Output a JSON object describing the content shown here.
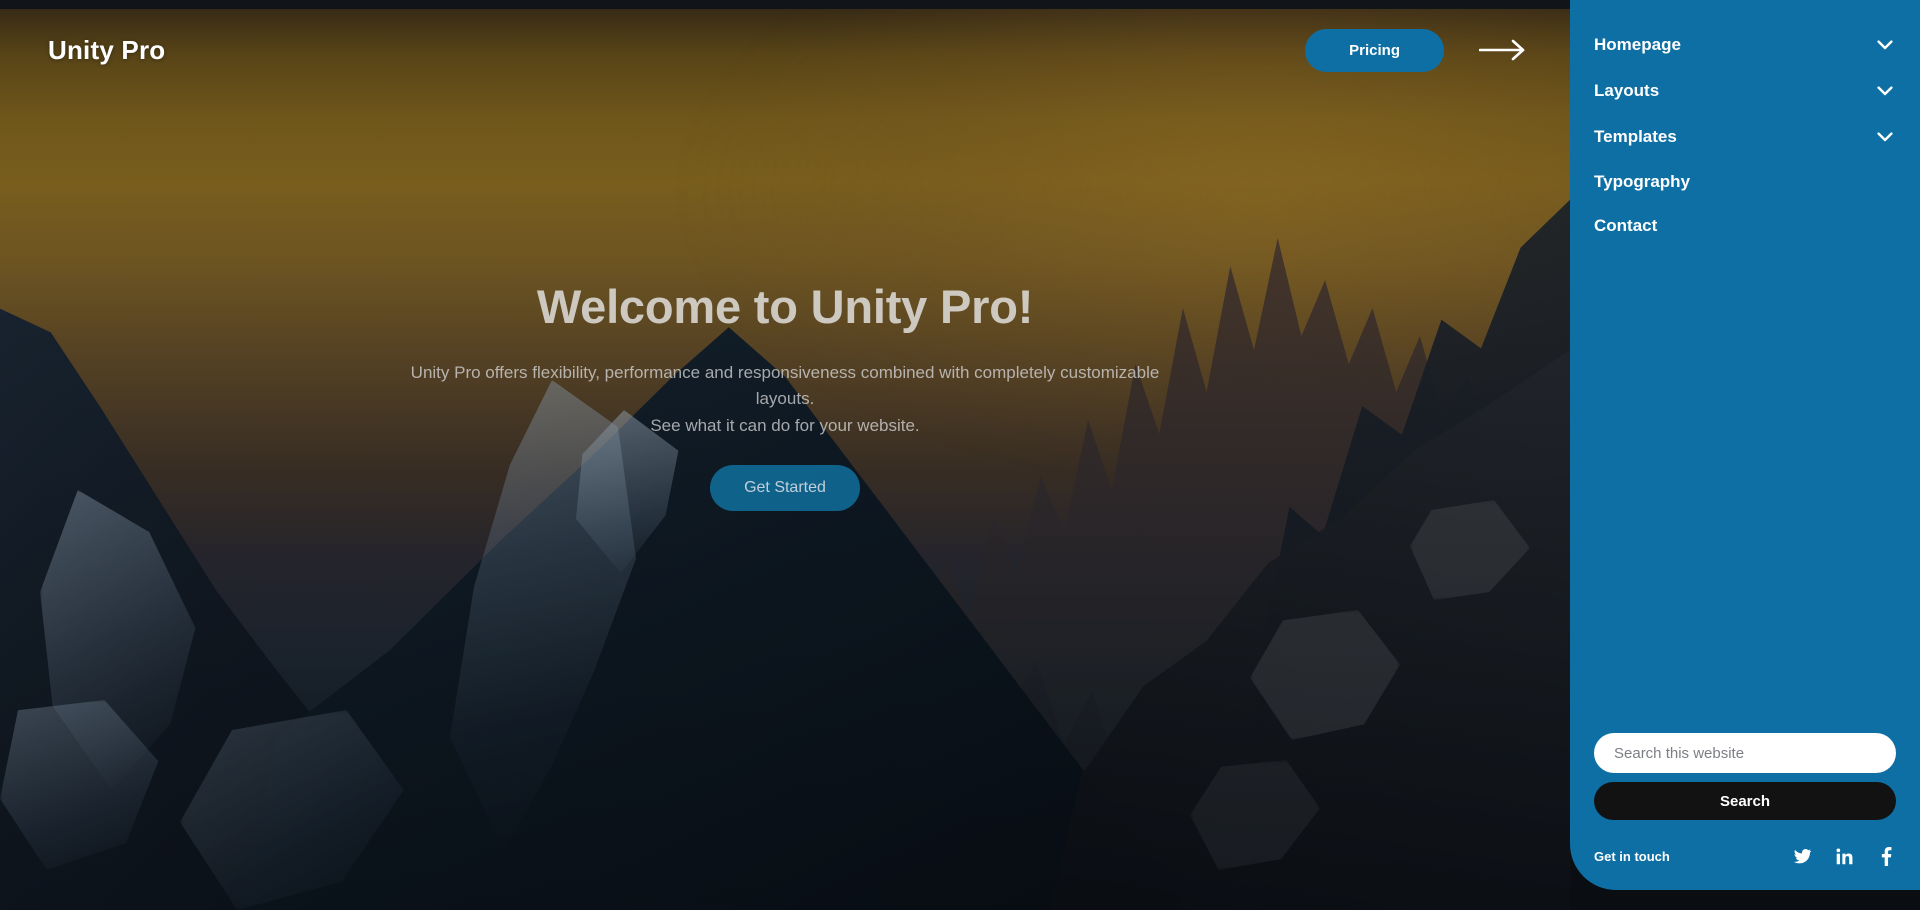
{
  "site": {
    "brand": "Unity Pro"
  },
  "header": {
    "pricing_label": "Pricing",
    "arrow_icon": "arrow-right-icon"
  },
  "hero": {
    "title": "Welcome to Unity Pro!",
    "subtitle_line1": "Unity Pro offers flexibility, performance and responsiveness combined with completely customizable layouts.",
    "subtitle_line2": "See what it can do for your website.",
    "cta_label": "Get Started"
  },
  "sidebar": {
    "items": [
      {
        "label": "Homepage",
        "has_submenu": true,
        "icon": "chevron-down-icon"
      },
      {
        "label": "Layouts",
        "has_submenu": true,
        "icon": "chevron-down-icon"
      },
      {
        "label": "Templates",
        "has_submenu": true,
        "icon": "chevron-down-icon"
      },
      {
        "label": "Typography",
        "has_submenu": false,
        "icon": ""
      },
      {
        "label": "Contact",
        "has_submenu": false,
        "icon": ""
      }
    ],
    "search": {
      "placeholder": "Search this website",
      "value": "",
      "button_label": "Search"
    },
    "footer": {
      "get_in_touch": "Get in touch",
      "social": [
        {
          "name": "twitter-icon"
        },
        {
          "name": "linkedin-icon"
        },
        {
          "name": "facebook-icon"
        }
      ]
    }
  },
  "colors": {
    "accent_blue": "#0e6fa4",
    "search_button": "#121212",
    "top_strip": "#111418",
    "text_white": "#ffffff"
  }
}
